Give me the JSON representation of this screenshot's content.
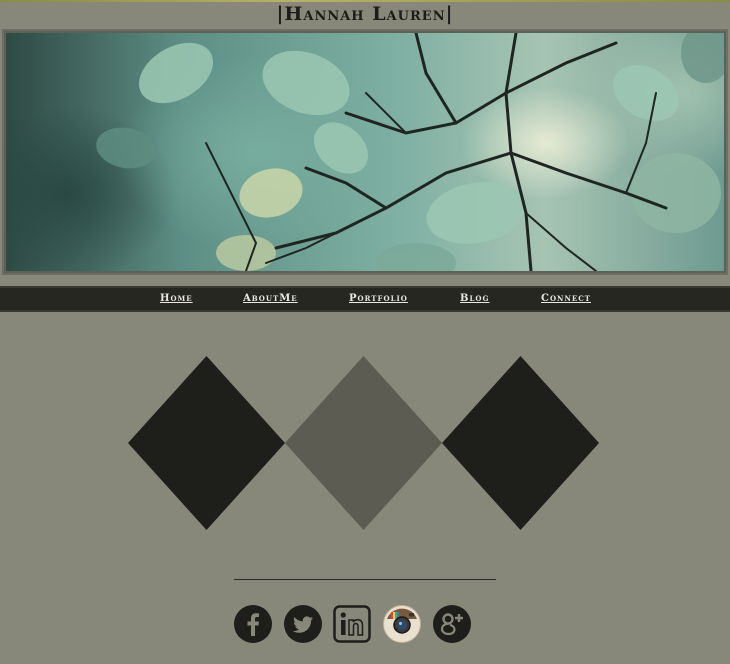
{
  "site": {
    "title": "|Hannah Lauren|"
  },
  "nav": {
    "items": [
      {
        "label": "Home"
      },
      {
        "label": "AboutMe"
      },
      {
        "label": "Portfolio"
      },
      {
        "label": "Blog"
      },
      {
        "label": "Connect"
      }
    ]
  },
  "diamonds": [
    {
      "color": "#1e1e1a"
    },
    {
      "color": "#5c5c52"
    },
    {
      "color": "#1e1e1a"
    }
  ],
  "social": [
    {
      "icon": "facebook-icon"
    },
    {
      "icon": "twitter-icon"
    },
    {
      "icon": "linkedin-icon"
    },
    {
      "icon": "instagram-icon"
    },
    {
      "icon": "google-plus-icon"
    }
  ],
  "colors": {
    "background": "#87877a",
    "navbar": "#272722",
    "text_dark": "#1c1c18",
    "nav_text": "#e8e8e0"
  }
}
